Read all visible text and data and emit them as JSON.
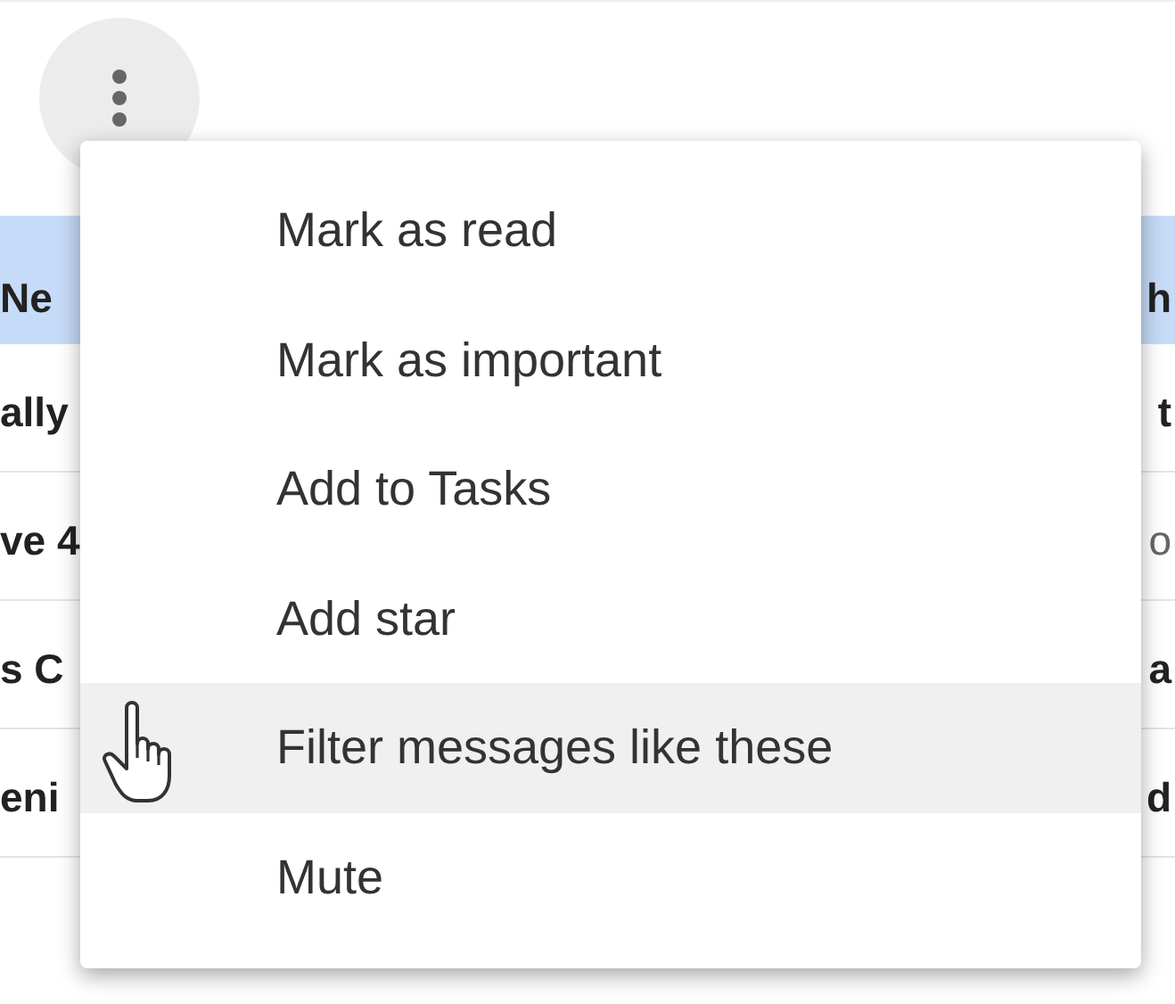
{
  "more_button": {
    "kind": "kebab"
  },
  "rows": [
    {
      "kind": "header",
      "left": "Ne",
      "right": "h",
      "left_bold": true,
      "right_bold": true
    },
    {
      "kind": "row",
      "left": "ally",
      "right": "t",
      "left_bold": true,
      "right_bold": true
    },
    {
      "kind": "row",
      "left": "ve 4",
      "right": "o",
      "left_bold": true,
      "right_bold": false
    },
    {
      "kind": "row",
      "left": "s C",
      "right": "a",
      "left_bold": true,
      "right_bold": true
    },
    {
      "kind": "row",
      "left": "eni",
      "right": "d",
      "left_bold": true,
      "right_bold": true
    }
  ],
  "menu": {
    "items": [
      {
        "label": "Mark as read",
        "selected": false
      },
      {
        "label": "Mark as important",
        "selected": false
      },
      {
        "label": "Add to Tasks",
        "selected": false
      },
      {
        "label": "Add star",
        "selected": false
      },
      {
        "label": "Filter messages like these",
        "selected": true
      },
      {
        "label": "Mute",
        "selected": false
      }
    ]
  }
}
